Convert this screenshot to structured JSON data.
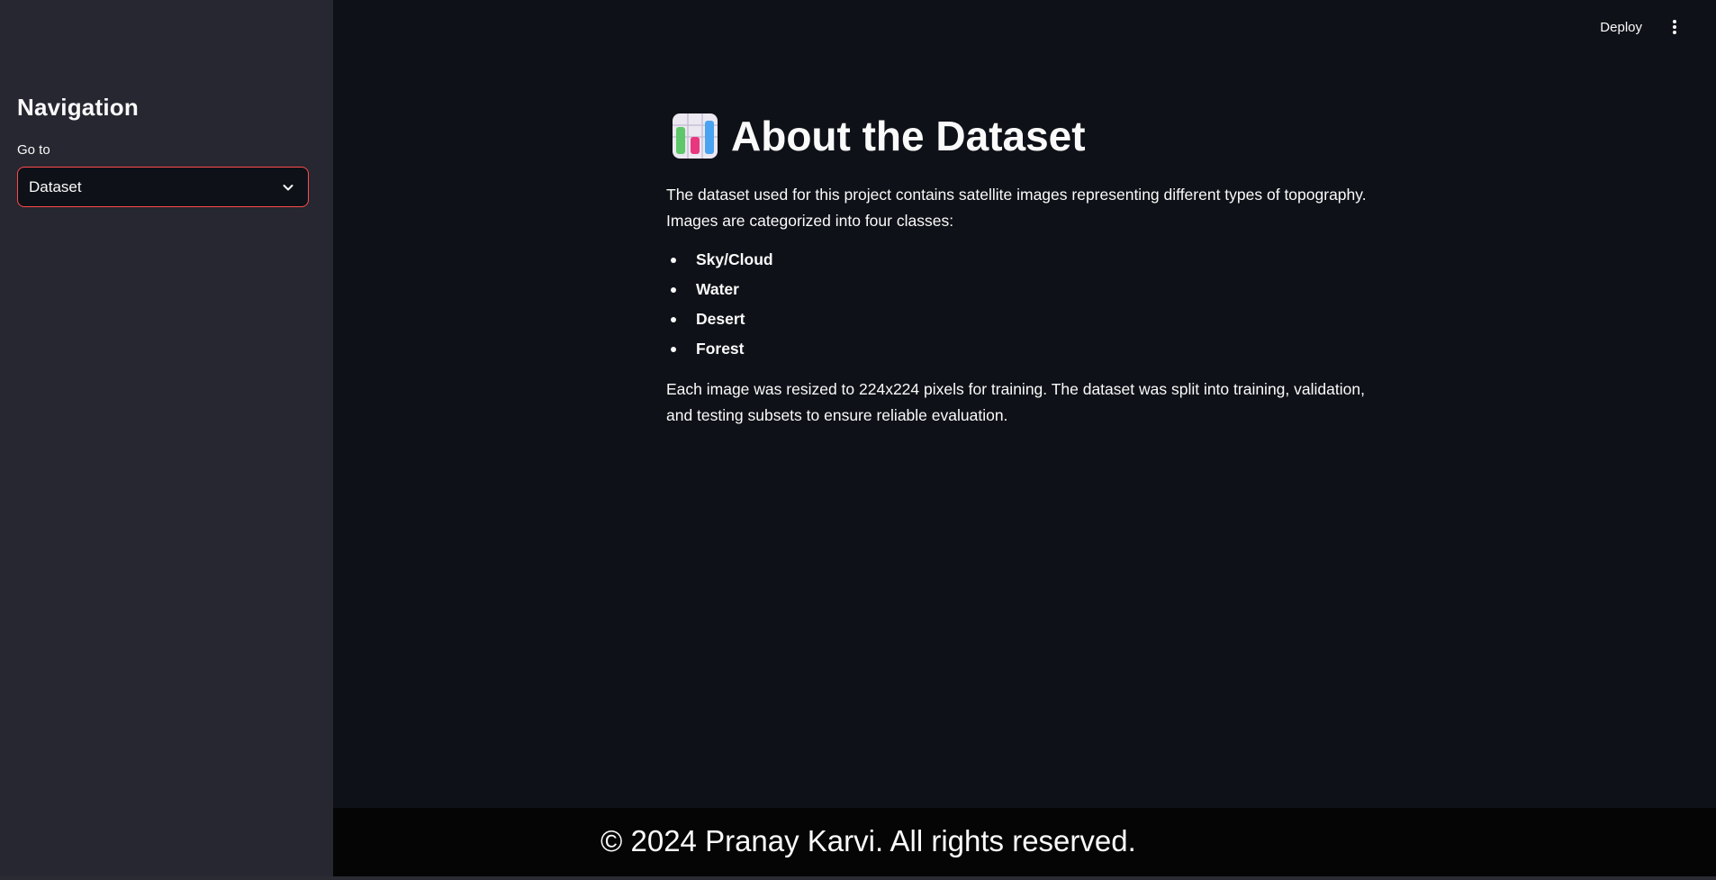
{
  "sidebar": {
    "title": "Navigation",
    "select": {
      "label": "Go to",
      "value": "Dataset"
    }
  },
  "toolbar": {
    "deploy_label": "Deploy"
  },
  "main": {
    "title": "About the Dataset",
    "title_icon": "bar-chart-icon",
    "intro": "The dataset used for this project contains satellite images representing different types of topography. Images are categorized into four classes:",
    "classes": [
      "Sky/Cloud",
      "Water",
      "Desert",
      "Forest"
    ],
    "details": "Each image was resized to 224x224 pixels for training. The dataset was split into training, validation, and testing subsets to ensure reliable evaluation."
  },
  "footer": {
    "text": "© 2024 Pranay Karvi. All rights reserved."
  },
  "colors": {
    "background": "#0e1117",
    "sidebar": "#262730",
    "accent": "#ff4b4b",
    "text": "#fafafa",
    "footer": "#050505"
  }
}
